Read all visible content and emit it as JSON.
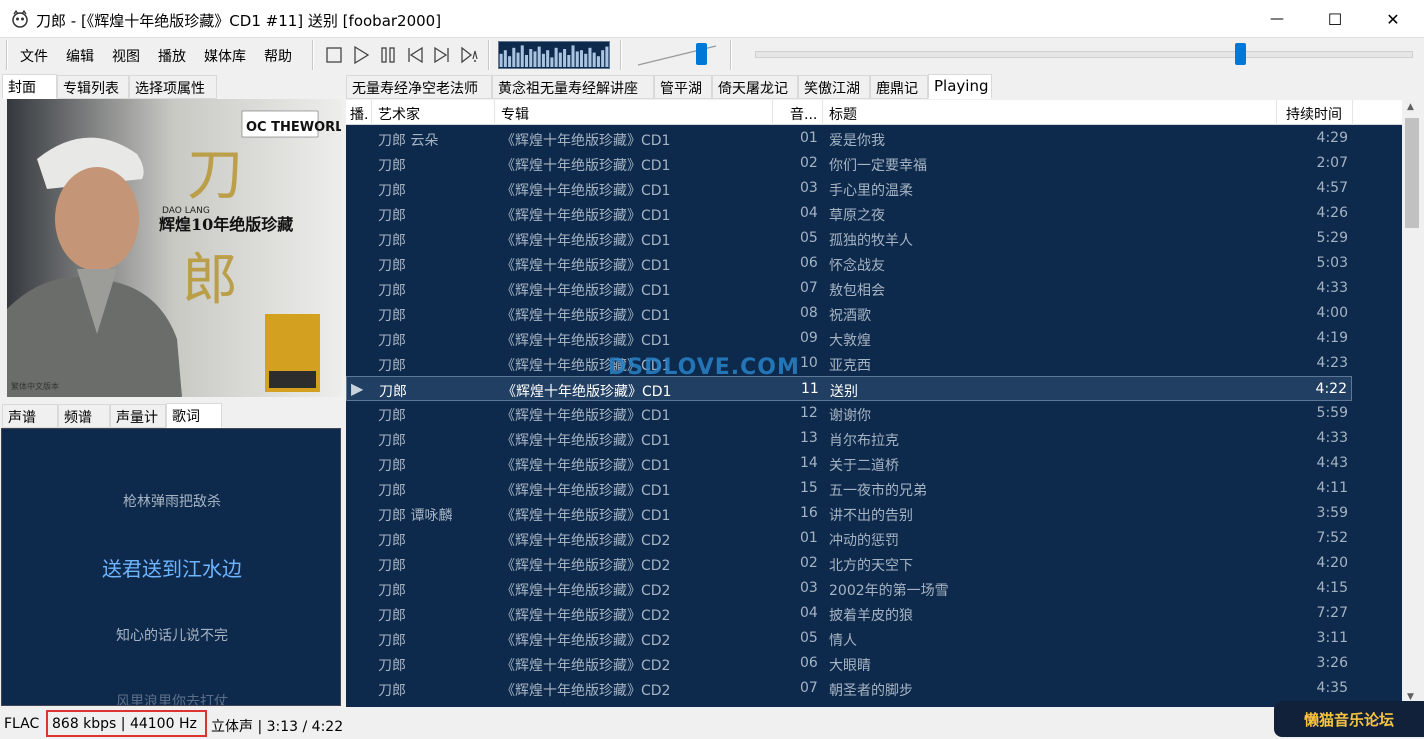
{
  "window": {
    "title": "刀郎 - [《辉煌十年绝版珍藏》CD1 #11] 送别  [foobar2000]",
    "controls": {
      "minimize": "—",
      "maximize": "☐",
      "close": "✕"
    }
  },
  "menu": [
    "文件",
    "编辑",
    "视图",
    "播放",
    "媒体库",
    "帮助"
  ],
  "transport_icons": [
    "stop-icon",
    "play-icon",
    "pause-icon",
    "previous-icon",
    "next-icon",
    "random-icon"
  ],
  "visualizer": {
    "levels": [
      0.55,
      0.7,
      0.45,
      0.8,
      0.6,
      0.9,
      0.5,
      0.75,
      0.65,
      0.85,
      0.55,
      0.7,
      0.4,
      0.8,
      0.6,
      0.75,
      0.5,
      0.9,
      0.65,
      0.7,
      0.55,
      0.8,
      0.6,
      0.45,
      0.7,
      0.85
    ]
  },
  "volume_level": 0.77,
  "seek_position": 0.74,
  "left_tabs_top": [
    "封面",
    "专辑列表",
    "选择项属性"
  ],
  "left_tabs_bottom": [
    "声谱",
    "频谱",
    "声量计",
    "歌词"
  ],
  "cover": {
    "album_text": "辉煌10年绝版珍藏",
    "artist_latin": "DAO LANG",
    "big_char_1": "刀",
    "big_char_2": "郎",
    "badge": "OC THEWORLD",
    "footer": "繁体中文版本"
  },
  "lyrics": [
    {
      "text": "枪林弹雨把敌杀",
      "current": false
    },
    {
      "text": "送君送到江水边",
      "current": true
    },
    {
      "text": "知心的话儿说不完",
      "current": false
    },
    {
      "text": "风里浪里你去打仗",
      "current": false
    }
  ],
  "playlist_tabs": [
    "无量寿经净空老法师",
    "黄念祖无量寿经解讲座",
    "管平湖",
    "倚天屠龙记",
    "笑傲江湖",
    "鹿鼎记",
    "Playing"
  ],
  "columns": {
    "playing": "播.",
    "artist": "艺术家",
    "album": "专辑",
    "track": "音...",
    "title": "标题",
    "duration": "持续时间"
  },
  "tracks": [
    {
      "artist": "刀郎 云朵",
      "album": "《辉煌十年绝版珍藏》CD1",
      "track": "01",
      "title": "爱是你我",
      "duration": "4:29"
    },
    {
      "artist": "刀郎",
      "album": "《辉煌十年绝版珍藏》CD1",
      "track": "02",
      "title": "你们一定要幸福",
      "duration": "2:07"
    },
    {
      "artist": "刀郎",
      "album": "《辉煌十年绝版珍藏》CD1",
      "track": "03",
      "title": "手心里的温柔",
      "duration": "4:57"
    },
    {
      "artist": "刀郎",
      "album": "《辉煌十年绝版珍藏》CD1",
      "track": "04",
      "title": "草原之夜",
      "duration": "4:26"
    },
    {
      "artist": "刀郎",
      "album": "《辉煌十年绝版珍藏》CD1",
      "track": "05",
      "title": "孤独的牧羊人",
      "duration": "5:29"
    },
    {
      "artist": "刀郎",
      "album": "《辉煌十年绝版珍藏》CD1",
      "track": "06",
      "title": "怀念战友",
      "duration": "5:03"
    },
    {
      "artist": "刀郎",
      "album": "《辉煌十年绝版珍藏》CD1",
      "track": "07",
      "title": "敖包相会",
      "duration": "4:33"
    },
    {
      "artist": "刀郎",
      "album": "《辉煌十年绝版珍藏》CD1",
      "track": "08",
      "title": "祝酒歌",
      "duration": "4:00"
    },
    {
      "artist": "刀郎",
      "album": "《辉煌十年绝版珍藏》CD1",
      "track": "09",
      "title": "大敦煌",
      "duration": "4:19"
    },
    {
      "artist": "刀郎",
      "album": "《辉煌十年绝版珍藏》CD1",
      "track": "10",
      "title": "亚克西",
      "duration": "4:23"
    },
    {
      "artist": "刀郎",
      "album": "《辉煌十年绝版珍藏》CD1",
      "track": "11",
      "title": "送别",
      "duration": "4:22",
      "playing": true
    },
    {
      "artist": "刀郎",
      "album": "《辉煌十年绝版珍藏》CD1",
      "track": "12",
      "title": "谢谢你",
      "duration": "5:59"
    },
    {
      "artist": "刀郎",
      "album": "《辉煌十年绝版珍藏》CD1",
      "track": "13",
      "title": "肖尔布拉克",
      "duration": "4:33"
    },
    {
      "artist": "刀郎",
      "album": "《辉煌十年绝版珍藏》CD1",
      "track": "14",
      "title": "关于二道桥",
      "duration": "4:43"
    },
    {
      "artist": "刀郎",
      "album": "《辉煌十年绝版珍藏》CD1",
      "track": "15",
      "title": "五一夜市的兄弟",
      "duration": "4:11"
    },
    {
      "artist": "刀郎 谭咏麟",
      "album": "《辉煌十年绝版珍藏》CD1",
      "track": "16",
      "title": "讲不出的告别",
      "duration": "3:59"
    },
    {
      "artist": "刀郎",
      "album": "《辉煌十年绝版珍藏》CD2",
      "track": "01",
      "title": "冲动的惩罚",
      "duration": "7:52"
    },
    {
      "artist": "刀郎",
      "album": "《辉煌十年绝版珍藏》CD2",
      "track": "02",
      "title": "北方的天空下",
      "duration": "4:20"
    },
    {
      "artist": "刀郎",
      "album": "《辉煌十年绝版珍藏》CD2",
      "track": "03",
      "title": "2002年的第一场雪",
      "duration": "4:15"
    },
    {
      "artist": "刀郎",
      "album": "《辉煌十年绝版珍藏》CD2",
      "track": "04",
      "title": "披着羊皮的狼",
      "duration": "7:27"
    },
    {
      "artist": "刀郎",
      "album": "《辉煌十年绝版珍藏》CD2",
      "track": "05",
      "title": "情人",
      "duration": "3:11"
    },
    {
      "artist": "刀郎",
      "album": "《辉煌十年绝版珍藏》CD2",
      "track": "06",
      "title": "大眼睛",
      "duration": "3:26"
    },
    {
      "artist": "刀郎",
      "album": "《辉煌十年绝版珍藏》CD2",
      "track": "07",
      "title": "朝圣者的脚步",
      "duration": "4:35"
    }
  ],
  "status": {
    "codec": "FLAC",
    "bitrate": "868 kbps | 44100 Hz",
    "rest": "立体声 | 3:13 / 4:22"
  },
  "watermarks": {
    "site": "DSDLOVE.COM",
    "forum": "懒猫音乐论坛"
  },
  "colors": {
    "accent": "#0078d7",
    "panel_bg": "#0d2a4d",
    "row_text": "#a6b3c2",
    "lyric_current": "#6eb4ff",
    "highlight_box": "#dd3333"
  }
}
